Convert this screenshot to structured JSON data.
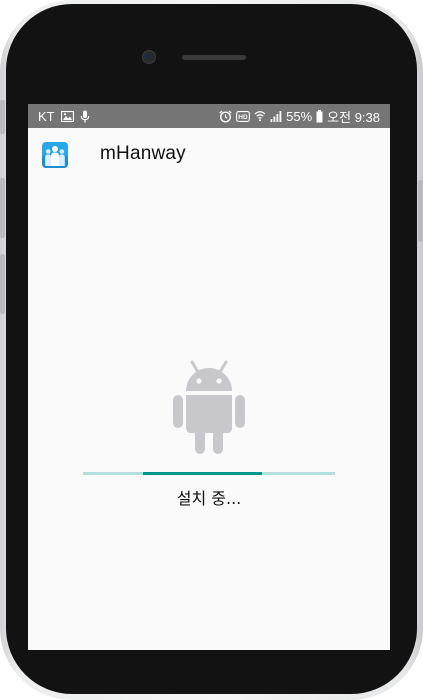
{
  "status_bar": {
    "carrier": "KT",
    "battery_percent": "55%",
    "time": "오전 9:38",
    "left_icons": [
      "image-icon",
      "microphone-icon"
    ],
    "right_icons": [
      "alarm-icon",
      "hd-icon",
      "wifi-icon",
      "signal-icon",
      "battery-icon"
    ]
  },
  "app_bar": {
    "title": "mHanway",
    "icon": "app-people-icon"
  },
  "main": {
    "icon": "android-robot-icon",
    "status_label": "설치 중...",
    "progress": {
      "indeterminate": true,
      "segment_start": 0.24,
      "segment_end": 0.71
    }
  },
  "colors": {
    "status_bar": "#757575",
    "screen_background": "#fafafa",
    "progress_track": "#b2dfdb",
    "progress_fill": "#009688",
    "android_icon": "#c8c8cc",
    "app_icon": "#29a8e8"
  }
}
